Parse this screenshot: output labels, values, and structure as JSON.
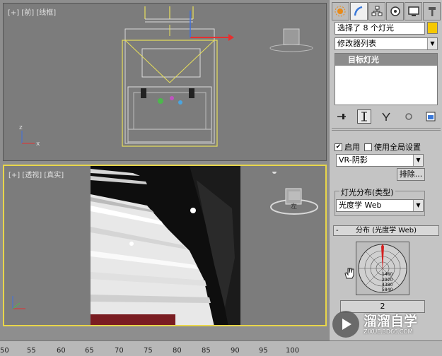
{
  "viewports": {
    "top_label": "[+] [前] [线框]",
    "bottom_label": "[+] [透视] [真实]",
    "gizmo_label": "左"
  },
  "panel": {
    "tabs": [
      "create-tab",
      "modify-tab",
      "hierarchy-tab",
      "motion-tab",
      "display-tab",
      "utilities-tab"
    ],
    "selection_field": "选择了 8 个灯光",
    "selection_color": "#f5c800",
    "modifier_list": "修改器列表",
    "stack_item": "目标灯光",
    "enabled_label": "启用",
    "enabled_checked": true,
    "global_settings_label": "使用全局设置",
    "global_settings_checked": false,
    "shadow_type": "VR-阴影",
    "exclude_button": "排除...",
    "distribution_group": "灯光分布(类型)",
    "distribution_value": "光度学 Web",
    "rollout_sign": "-",
    "rollout_title": "分布 (光度学 Web)",
    "web_values": [
      "1460",
      "2920",
      "4380",
      "5840"
    ],
    "web_file_button": "2"
  },
  "timeline": {
    "ticks": [
      "50",
      "55",
      "60",
      "65",
      "70",
      "75",
      "80",
      "85",
      "90",
      "95",
      "100"
    ]
  },
  "watermark": {
    "title": "溜溜自学",
    "subtitle": "ZIXUE.3D66.COM"
  }
}
